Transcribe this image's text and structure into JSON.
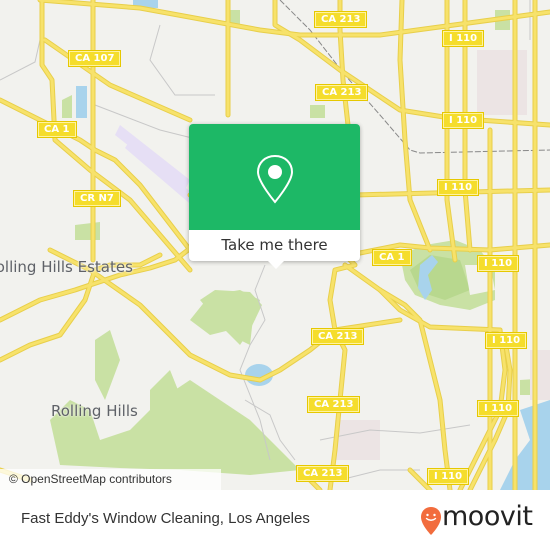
{
  "map": {
    "colors": {
      "background": "#f2f2ee",
      "road": "#f7e26b",
      "road_casing": "#e8cf4a",
      "park": "#c9e1a4",
      "water": "#a8d3ec",
      "minor_road": "#c8c8c8",
      "rail": "#888888",
      "airport": "#e6dff5",
      "industrial": "#ece4e4"
    },
    "road_labels": [
      {
        "id": "ca107",
        "text": "CA 107"
      },
      {
        "id": "ca1-west",
        "text": "CA 1"
      },
      {
        "id": "crn7",
        "text": "CR N7"
      },
      {
        "id": "ca213-top",
        "text": "CA 213"
      },
      {
        "id": "ca213-second",
        "text": "CA 213"
      },
      {
        "id": "i110-a",
        "text": "I 110"
      },
      {
        "id": "i110-b",
        "text": "I 110"
      },
      {
        "id": "i110-c",
        "text": "I 110"
      },
      {
        "id": "ca1-east",
        "text": "CA 1"
      },
      {
        "id": "i110-d",
        "text": "I 110"
      },
      {
        "id": "ca213-mid",
        "text": "CA 213"
      },
      {
        "id": "i110-e",
        "text": "I 110"
      },
      {
        "id": "ca213-low",
        "text": "CA 213"
      },
      {
        "id": "i110-f",
        "text": "I 110"
      },
      {
        "id": "ca213-bottom",
        "text": "CA 213"
      },
      {
        "id": "i110-g",
        "text": "I 110"
      }
    ],
    "place_labels": [
      {
        "id": "rolling-hills-estates",
        "text": "Rolling Hills Estates"
      },
      {
        "id": "rolling-hills",
        "text": "Rolling Hills"
      }
    ],
    "attribution": "© OpenStreetMap contributors"
  },
  "popup": {
    "button_label": "Take me there",
    "icon": "map-pin-icon",
    "color": "#1db866"
  },
  "footer": {
    "title": "Fast Eddy's Window Cleaning, Los Angeles",
    "brand": "moovit",
    "brand_color": "#f26c3d"
  }
}
